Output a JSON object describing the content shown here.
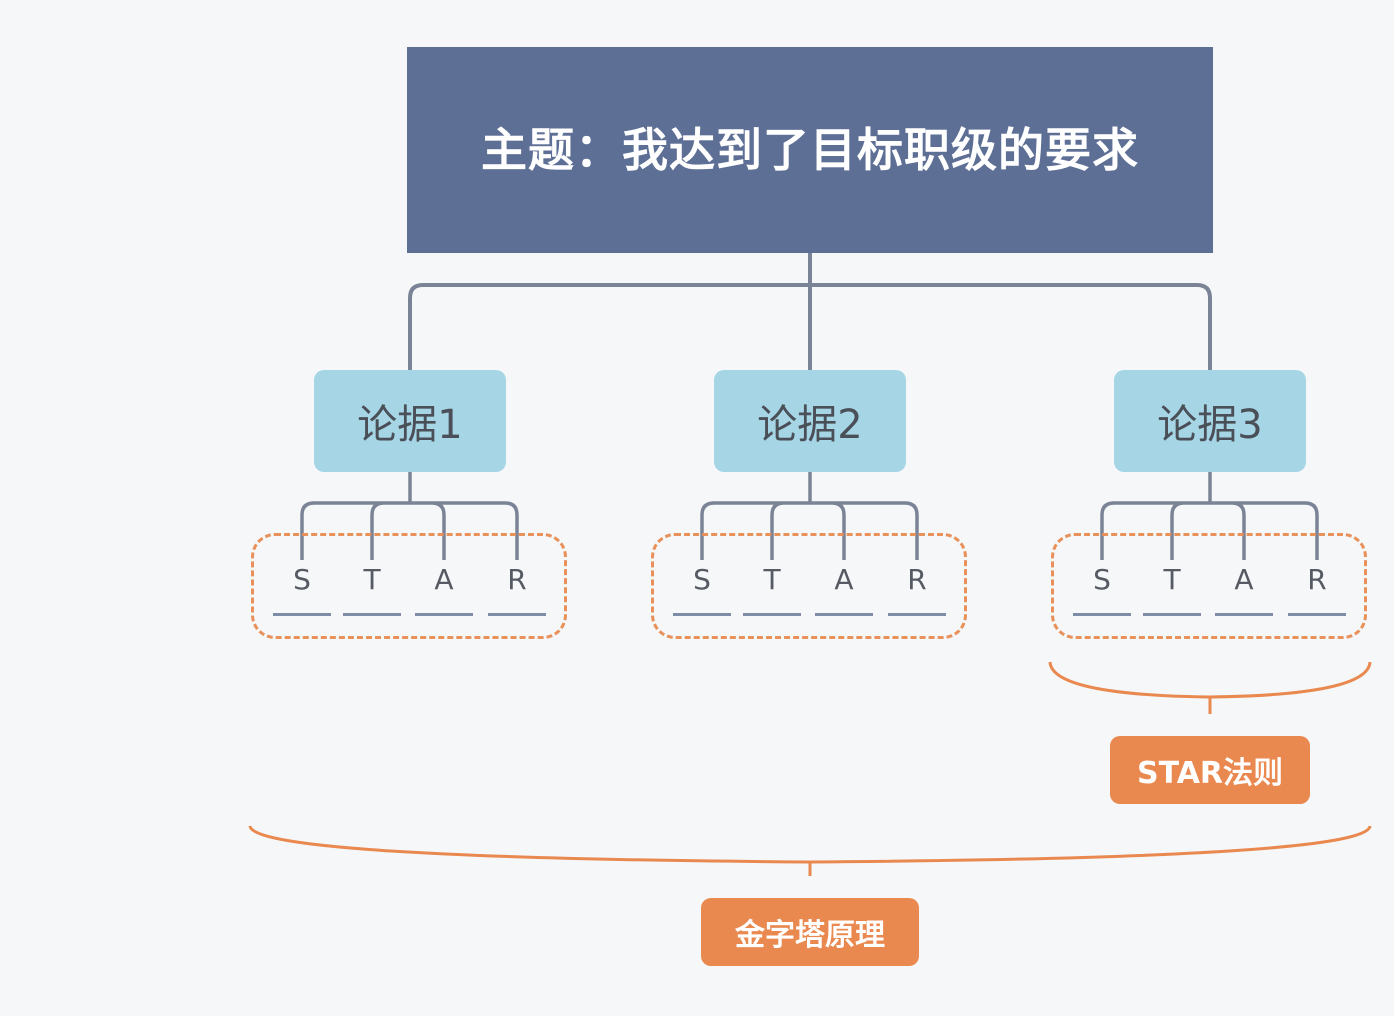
{
  "topic": {
    "text": "主题：我达到了目标职级的要求"
  },
  "arguments": [
    {
      "label": "论据1",
      "letters": [
        "S",
        "T",
        "A",
        "R"
      ]
    },
    {
      "label": "论据2",
      "letters": [
        "S",
        "T",
        "A",
        "R"
      ]
    },
    {
      "label": "论据3",
      "letters": [
        "S",
        "T",
        "A",
        "R"
      ]
    }
  ],
  "star_rule": {
    "label": "STAR法则"
  },
  "pyramid": {
    "label": "金字塔原理"
  },
  "colors": {
    "topic_fill": "#5e6f96",
    "argument_fill": "#a6d6e6",
    "connector": "#7a8496",
    "accent_orange": "#e9894f"
  }
}
